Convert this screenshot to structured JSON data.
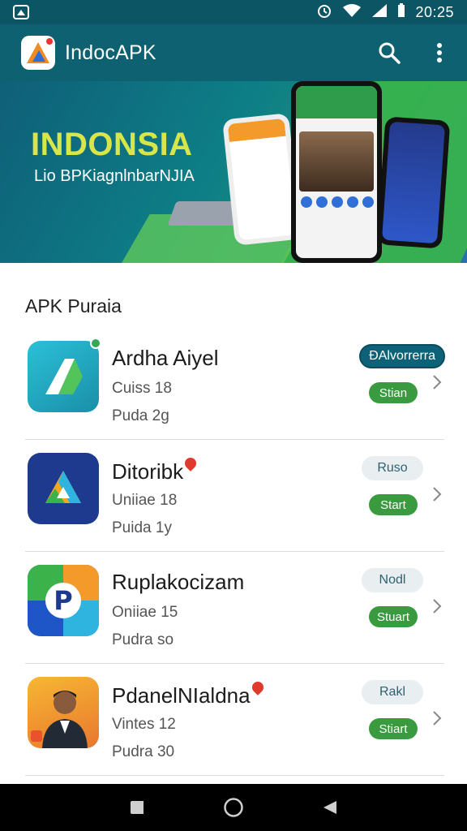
{
  "status_bar": {
    "time": "20:25",
    "icons": [
      "app-notification-icon",
      "alarm-icon",
      "wifi-icon",
      "signal-icon",
      "battery-icon"
    ]
  },
  "app_bar": {
    "title": "IndocAPK",
    "actions": [
      "search-icon",
      "more-vert-icon"
    ]
  },
  "banner": {
    "title": "INDONSIA",
    "subtitle": "Lio BPKiagnlnbarNJIA"
  },
  "section": {
    "title": "APK Puraia"
  },
  "apps": [
    {
      "name": "Ardha Aiyel",
      "meta1": "Cuiss 18",
      "meta2": "Puda 2g",
      "top_label": "ĐAlvorrerra",
      "top_style": "dark",
      "start_label": "Stian",
      "icon": "green-drive-icon",
      "badge_color": "#3aa655"
    },
    {
      "name": "Ditoribk",
      "meta1": "Uniiae 18",
      "meta2": "Puida 1y",
      "top_label": "Ruso",
      "top_style": "light",
      "start_label": "Start",
      "icon": "blue-triangle-icon"
    },
    {
      "name": "Ruplakocizam",
      "meta1": "Oniiae 15",
      "meta2": "Pudra so",
      "top_label": "Nodl",
      "top_style": "light",
      "start_label": "Stuart",
      "icon": "colorful-p-icon"
    },
    {
      "name": "PdanelNIaldna",
      "meta1": "Vintes 12",
      "meta2": "Pudra 30",
      "top_label": "Rakl",
      "top_style": "light",
      "start_label": "Stiart",
      "icon": "portrait-icon"
    }
  ],
  "nav_bar": {
    "buttons": [
      "back-icon",
      "home-icon",
      "recents-icon"
    ]
  },
  "colors": {
    "app_bar": "#0d6170",
    "status_bar": "#0c5564",
    "accent_green": "#3a9a3f",
    "banner_yellow": "#d9e64a"
  }
}
